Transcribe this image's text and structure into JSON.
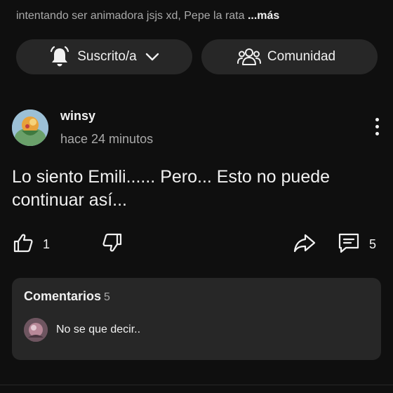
{
  "description": {
    "text": "intentando ser animadora jsjs xd, Pepe la rata ",
    "more_label": "...más"
  },
  "subscribe_button": {
    "label": "Suscrito/a",
    "icon": "bell-icon"
  },
  "community_button": {
    "label": "Comunidad",
    "icon": "people-icon"
  },
  "post": {
    "author": "winsy",
    "time": "hace 24 minutos",
    "text_line1": "Lo siento Emili...... Pero... Esto no puede",
    "text_line2": "continuar así...",
    "likes": "1",
    "comment_count": "5"
  },
  "comments_panel": {
    "title": "Comentarios",
    "count": "5",
    "top_comment": "No se que decir.."
  },
  "colors": {
    "background": "#0f0f0f",
    "surface": "#272727",
    "text": "#f1f1f1",
    "muted": "#aaaaaa"
  }
}
